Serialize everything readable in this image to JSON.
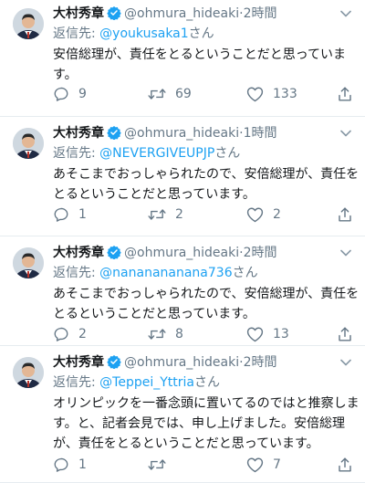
{
  "tweets": [
    {
      "name": "大村秀章",
      "handle": "@ohmura_hideaki",
      "dot": "·",
      "time": "2時間",
      "reply_prefix": "返信先:",
      "reply_to": "@youkusaka1",
      "reply_suffix": "さん",
      "lines": [
        "安倍総理が、責任をとるということだと思っていま",
        "す。"
      ],
      "replies": "9",
      "retweets": "69",
      "likes": "133"
    },
    {
      "name": "大村秀章",
      "handle": "@ohmura_hideaki",
      "dot": "·",
      "time": "1時間",
      "reply_prefix": "返信先:",
      "reply_to": "@NEVERGIVEUPJP",
      "reply_suffix": "さん",
      "lines": [
        "あそこまでおっしゃられたので、安倍総理が、責任を",
        "とるということだと思っています。"
      ],
      "replies": "1",
      "retweets": "2",
      "likes": "2"
    },
    {
      "name": "大村秀章",
      "handle": "@ohmura_hideaki",
      "dot": "·",
      "time": "2時間",
      "reply_prefix": "返信先:",
      "reply_to": "@nananananana736",
      "reply_suffix": "さん",
      "lines": [
        "あそこまでおっしゃられたので、安倍総理が、責任を",
        "とるということだと思っています。"
      ],
      "replies": "2",
      "retweets": "8",
      "likes": "13"
    },
    {
      "name": "大村秀章",
      "handle": "@ohmura_hideaki",
      "dot": "·",
      "time": "2時間",
      "reply_prefix": "返信先:",
      "reply_to": "@Teppei_Yttria",
      "reply_suffix": "さん",
      "lines": [
        "オリンピックを一番念頭に置いてるのではと推察しま",
        "す。と、記者会見では、申し上げました。安倍総理",
        "が、責任をとるということだと思っています。"
      ],
      "replies": "1",
      "retweets": "",
      "likes": "7"
    }
  ],
  "colors": {
    "accent": "#1da1f2",
    "muted": "#657786",
    "text": "#14171a",
    "divider": "#e6ecf0"
  },
  "icons": [
    "avatar",
    "verified-badge-icon",
    "chevron-down-icon",
    "reply-icon",
    "retweet-icon",
    "like-icon",
    "share-icon"
  ]
}
